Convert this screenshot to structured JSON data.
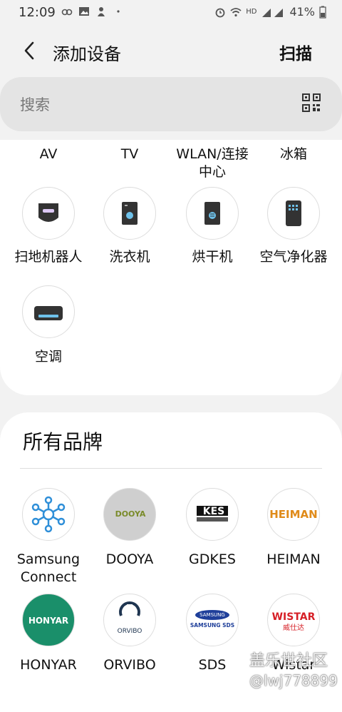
{
  "status_bar": {
    "time": "12:09",
    "battery": "41%",
    "network": "4G"
  },
  "header": {
    "title": "添加设备",
    "scan_label": "扫描"
  },
  "search": {
    "placeholder": "搜索"
  },
  "categories_top_row": [
    "AV",
    "TV",
    "WLAN/连接中心",
    "冰箱"
  ],
  "categories": [
    {
      "label": "扫地机器人",
      "icon": "robot-vacuum-icon"
    },
    {
      "label": "洗衣机",
      "icon": "washer-icon"
    },
    {
      "label": "烘干机",
      "icon": "dryer-icon"
    },
    {
      "label": "空气净化器",
      "icon": "air-purifier-icon"
    },
    {
      "label": "空调",
      "icon": "air-conditioner-icon"
    }
  ],
  "brands": {
    "title": "所有品牌",
    "items": [
      {
        "label": "Samsung Connect",
        "logo": "samsung-connect-logo"
      },
      {
        "label": "DOOYA",
        "logo": "dooya-logo"
      },
      {
        "label": "GDKES",
        "logo": "gdkes-logo"
      },
      {
        "label": "HEIMAN",
        "logo": "heiman-logo"
      },
      {
        "label": "HONYAR",
        "logo": "honyar-logo"
      },
      {
        "label": "ORVIBO",
        "logo": "orvibo-logo"
      },
      {
        "label": "SDS",
        "logo": "samsung-sds-logo"
      },
      {
        "label": "Wistar",
        "logo": "wistar-logo"
      }
    ],
    "logo_text": {
      "dooya": "DOOYA",
      "kes": "KES",
      "heiman": "HEIMAN",
      "honyar": "HONYAR",
      "orvibo": "ORVIBO",
      "samsung": "SAMSUNG",
      "sds": "SAMSUNG SDS",
      "wistar": "WISTAR",
      "wistar_cn": "威仕达"
    }
  },
  "watermark": {
    "line1": "盖乐世社区",
    "line2": "@lwj778899"
  },
  "colors": {
    "honyar_green": "#1a8f6a",
    "heiman_orange": "#e08b1a",
    "wistar_red": "#d61f26",
    "accent_blue": "#2f8fd8"
  }
}
